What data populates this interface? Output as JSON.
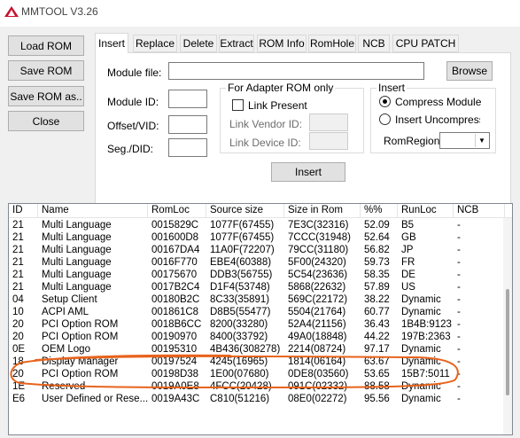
{
  "window": {
    "title": "MMTOOL V3.26"
  },
  "left_buttons": {
    "load_rom": "Load ROM",
    "save_rom": "Save ROM",
    "save_rom_as": "Save ROM as..",
    "close": "Close"
  },
  "tabs": [
    "Insert",
    "Replace",
    "Delete",
    "Extract",
    "ROM Info",
    "RomHole",
    "NCB",
    "CPU PATCH"
  ],
  "insert_tab": {
    "module_file_label": "Module file:",
    "module_file_value": "",
    "browse_button": "Browse",
    "module_id_label": "Module ID:",
    "offset_vid_label": "Offset/VID:",
    "seg_did_label": "Seg./DID:",
    "adapter_group": {
      "title": "For Adapter ROM only",
      "link_present": "Link Present",
      "link_vendor_id": "Link Vendor ID:",
      "link_device_id": "Link Device ID:"
    },
    "insert_group": {
      "title": "Insert",
      "compress_module": "Compress Module",
      "insert_uncompressed": "Insert Uncompressec",
      "selected_option": "compress_module",
      "romregion_label": "RomRegion",
      "romregion_value": ""
    },
    "insert_button": "Insert"
  },
  "module_list": {
    "columns": [
      "ID",
      "Name",
      "RomLoc",
      "Source size",
      "Size in Rom",
      "%%",
      "RunLoc",
      "NCB"
    ],
    "rows": [
      [
        "21",
        "Multi Language",
        "0015829C",
        "1077F(67455)",
        "7E3C(32316)",
        "52.09",
        "B5",
        "-"
      ],
      [
        "21",
        "Multi Language",
        "001600D8",
        "1077F(67455)",
        "7CCC(31948)",
        "52.64",
        "GB",
        "-"
      ],
      [
        "21",
        "Multi Language",
        "00167DA4",
        "11A0F(72207)",
        "79CC(31180)",
        "56.82",
        "JP",
        "-"
      ],
      [
        "21",
        "Multi Language",
        "0016F770",
        "EBE4(60388)",
        "5F00(24320)",
        "59.73",
        "FR",
        "-"
      ],
      [
        "21",
        "Multi Language",
        "00175670",
        "DDB3(56755)",
        "5C54(23636)",
        "58.35",
        "DE",
        "-"
      ],
      [
        "21",
        "Multi Language",
        "0017B2C4",
        "D1F4(53748)",
        "5868(22632)",
        "57.89",
        "US",
        "-"
      ],
      [
        "04",
        "Setup Client",
        "00180B2C",
        "8C33(35891)",
        "569C(22172)",
        "38.22",
        "Dynamic",
        "-"
      ],
      [
        "10",
        "ACPI AML",
        "001861C8",
        "D8B5(55477)",
        "5504(21764)",
        "60.77",
        "Dynamic",
        "-"
      ],
      [
        "20",
        "PCI Option ROM",
        "0018B6CC",
        "8200(33280)",
        "52A4(21156)",
        "36.43",
        "1B4B:9123",
        "-"
      ],
      [
        "20",
        "PCI Option ROM",
        "00190970",
        "8400(33792)",
        "49A0(18848)",
        "44.22",
        "197B:2363",
        "-"
      ],
      [
        "0E",
        "OEM Logo",
        "00195310",
        "4B436(308278)",
        "2214(08724)",
        "97.17",
        "Dynamic",
        "-"
      ],
      [
        "18",
        "Display Manager",
        "00197524",
        "4245(16965)",
        "1814(06164)",
        "63.67",
        "Dynamic",
        "-"
      ],
      [
        "20",
        "PCI Option ROM",
        "00198D38",
        "1E00(07680)",
        "0DE8(03560)",
        "53.65",
        "15B7:5011",
        "-"
      ],
      [
        "1E",
        "Reserved",
        "0019A0E8",
        "4FCC(20428)",
        "091C(02332)",
        "88.58",
        "Dynamic",
        "-"
      ],
      [
        "E6",
        "User Defined or Rese...",
        "0019A43C",
        "C810(51216)",
        "08E0(02272)",
        "95.56",
        "Dynamic",
        "-"
      ]
    ]
  },
  "colors": {
    "annotation_stroke": "#e8631c",
    "window_bg": "#f0f0f0",
    "icon_red": "#c8102e"
  }
}
